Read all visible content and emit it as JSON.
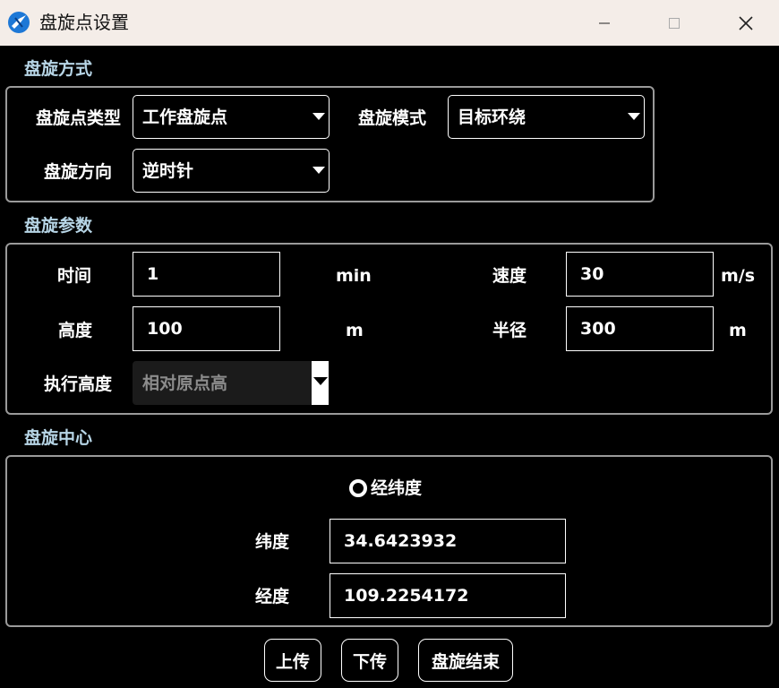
{
  "window": {
    "title": "盘旋点设置",
    "icon": "app-logo-icon",
    "controls": [
      "minimize-icon",
      "maximize-icon",
      "close-icon"
    ]
  },
  "mode_section": {
    "title": "盘旋方式",
    "point_type_label": "盘旋点类型",
    "point_type_value": "工作盘旋点",
    "mode_label": "盘旋模式",
    "mode_value": "目标环绕",
    "direction_label": "盘旋方向",
    "direction_value": "逆时针"
  },
  "params_section": {
    "title": "盘旋参数",
    "time_label": "时间",
    "time_value": "1",
    "time_unit": "min",
    "speed_label": "速度",
    "speed_value": "30",
    "speed_unit": "m/s",
    "altitude_label": "高度",
    "altitude_value": "100",
    "altitude_unit": "m",
    "radius_label": "半径",
    "radius_value": "300",
    "radius_unit": "m",
    "exec_altitude_label": "执行高度",
    "exec_altitude_value": "相对原点高"
  },
  "center_section": {
    "title": "盘旋中心",
    "radio_label": "经纬度",
    "latitude_label": "纬度",
    "latitude_value": "34.6423932",
    "longitude_label": "经度",
    "longitude_value": "109.2254172"
  },
  "buttons": {
    "upload": "上传",
    "download": "下传",
    "end_orbit": "盘旋结束"
  },
  "colors": {
    "titlebar_bg": "#f4ede8",
    "section_title": "#b7d5e6",
    "background": "#000000"
  }
}
